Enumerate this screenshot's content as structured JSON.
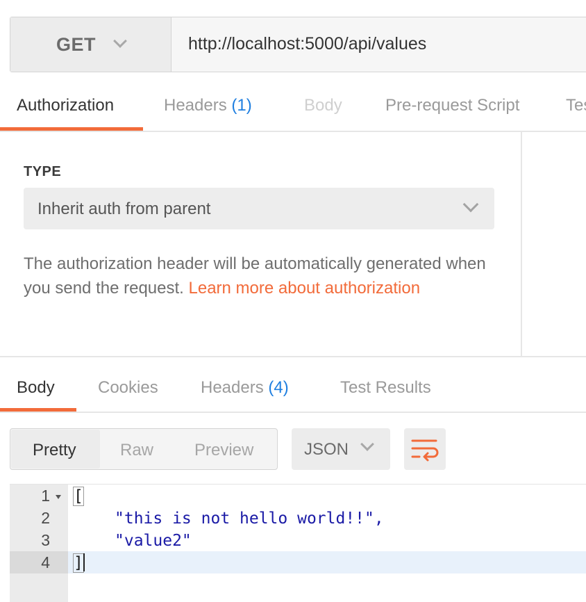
{
  "request": {
    "method": "GET",
    "url": "http://localhost:5000/api/values"
  },
  "request_tabs": [
    {
      "label": "Authorization"
    },
    {
      "label": "Headers",
      "count": "(1)"
    },
    {
      "label": "Body"
    },
    {
      "label": "Pre-request Script"
    },
    {
      "label": "Tes"
    }
  ],
  "auth": {
    "type_label": "TYPE",
    "type_value": "Inherit auth from parent",
    "description": "The authorization header will be automatically generated when you send the request.",
    "link_text": "Learn more about authorization"
  },
  "response_tabs": [
    {
      "label": "Body"
    },
    {
      "label": "Cookies"
    },
    {
      "label": "Headers",
      "count": "(4)"
    },
    {
      "label": "Test Results"
    }
  ],
  "format": {
    "modes": [
      "Pretty",
      "Raw",
      "Preview"
    ],
    "language": "JSON"
  },
  "editor": {
    "line_numbers": [
      "1",
      "2",
      "3",
      "4"
    ],
    "lines": [
      "[",
      "\"this is not hello world!!\",",
      "\"value2\"",
      "]"
    ]
  },
  "colors": {
    "accent": "#f26b3a",
    "count_blue": "#1f7fe0",
    "string_blue": "#1a1aa6"
  }
}
